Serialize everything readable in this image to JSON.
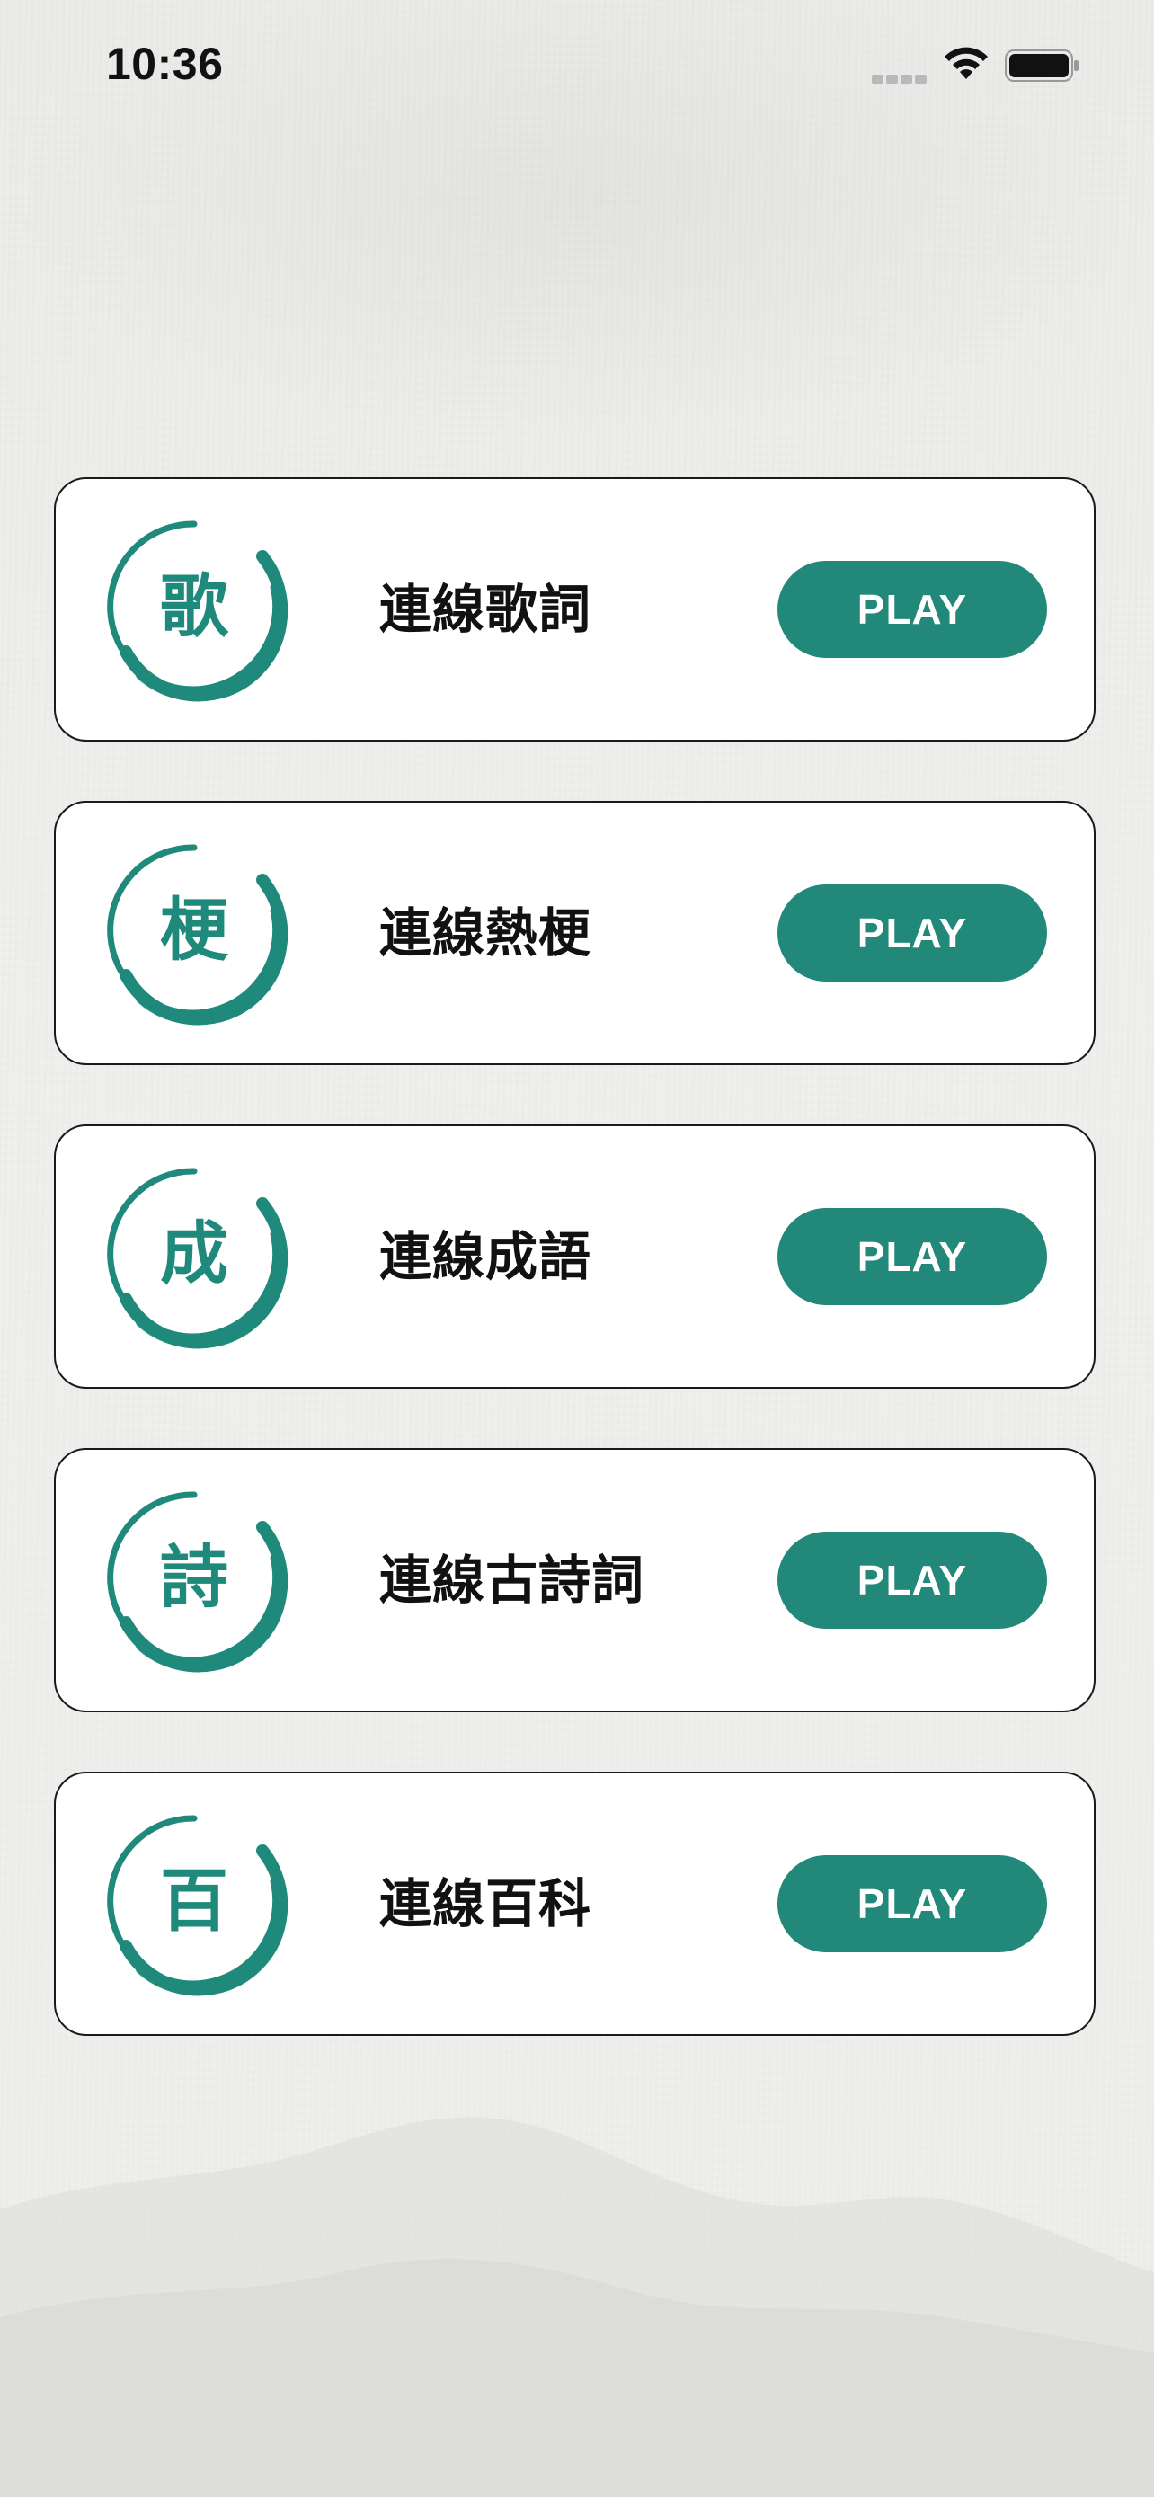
{
  "status_bar": {
    "time": "10:36",
    "icons": [
      "signal-icon",
      "wifi-icon",
      "battery-icon"
    ]
  },
  "theme": {
    "accent": "#22897a",
    "icon_color": "#1f8a7b",
    "card_background": "#ffffff",
    "card_border": "#1a1a1a",
    "page_background": "#eeeeec"
  },
  "games": [
    {
      "icon_char": "歌",
      "title": "連線歌詞",
      "button_label": "PLAY"
    },
    {
      "icon_char": "梗",
      "title": "連線熱梗",
      "button_label": "PLAY"
    },
    {
      "icon_char": "成",
      "title": "連線成語",
      "button_label": "PLAY"
    },
    {
      "icon_char": "詩",
      "title": "連線古詩詞",
      "button_label": "PLAY"
    },
    {
      "icon_char": "百",
      "title": "連線百科",
      "button_label": "PLAY"
    }
  ]
}
